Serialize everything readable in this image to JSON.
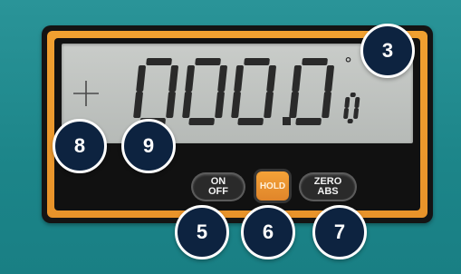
{
  "display": {
    "main_value": "000.0",
    "sub_digit": "0",
    "degree_symbol": "°",
    "sign_indicator": "plus-icon"
  },
  "buttons": {
    "on_off": {
      "line1": "ON",
      "line2": "OFF"
    },
    "hold": {
      "label": "HOLD"
    },
    "zero_abs": {
      "line1": "ZERO",
      "line2": "ABS"
    }
  },
  "callouts": {
    "c3": "3",
    "c5": "5",
    "c6": "6",
    "c7": "7",
    "c8": "8",
    "c9": "9"
  },
  "colors": {
    "background": "#1f8a8f",
    "bezel": "#e8932a",
    "lcd": "#c2c5c2",
    "segment": "#2a2a2a",
    "callout_fill": "#0d2340",
    "hold_button": "#f0962f"
  }
}
